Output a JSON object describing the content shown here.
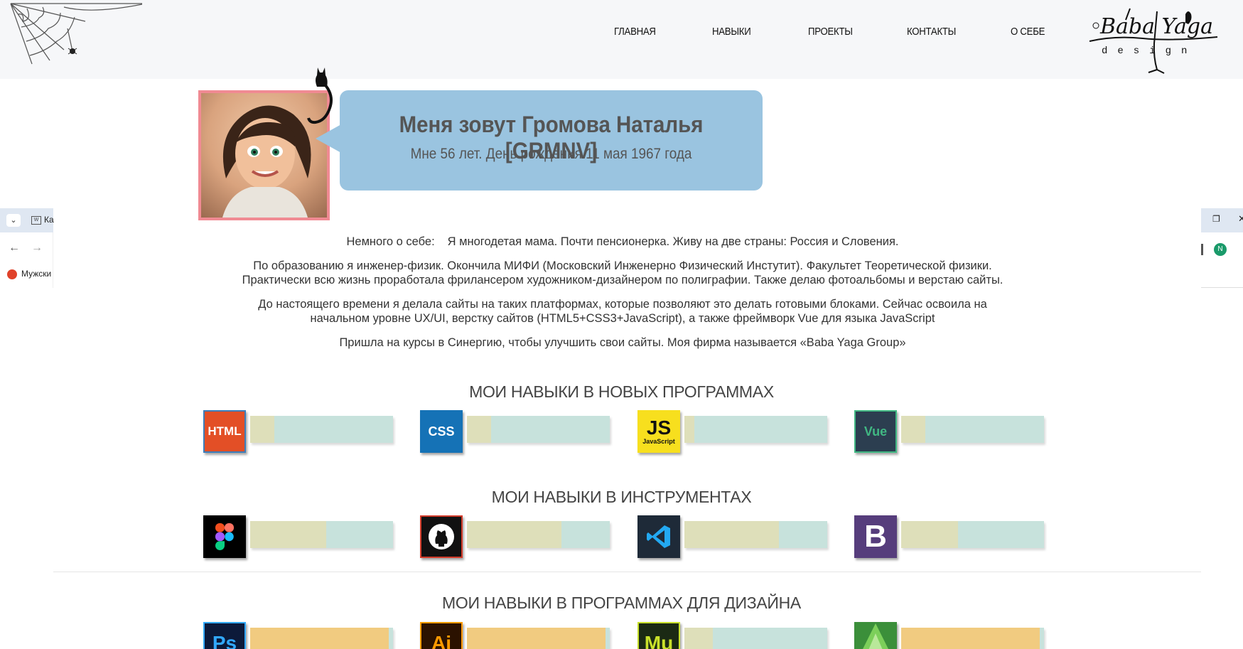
{
  "nav": {
    "items": [
      "ГЛАВНАЯ",
      "НАВЫКИ",
      "ПРОЕКТЫ",
      "КОНТАКТЫ",
      "О СЕБЕ"
    ]
  },
  "logo": {
    "main": "Baba Yaga",
    "sub": "design"
  },
  "profile": {
    "title": "Меня зовут Громова Наталья [GRMNV]",
    "subtitle": "Мне 56 лет. День рождения 11 мая 1967 года"
  },
  "about": {
    "label": "Немного о себе:",
    "line1": "Я многодетая мама. Почти пенсионерка. Живу на две страны: Россия и Словения.",
    "p2": "По образованию я инженер-физик. Окончила МИФИ (Московский Инженерно Физический Инстутит). Факультет Теоретической физики. Практически всю жизнь проработала фрилансером художником-дизайнером по полиграфии. Также делаю фотоальбомы и верстаю сайты.",
    "p3": "До настоящего времени я делала сайты на таких платформах, которые позволяют это делать готовыми блоками. Сейчас освоила на начальном уровне UX/UI, верстку сайтов (HTML5+CSS3+JavaScript), а также фреймворк Vue для языка JavaScript",
    "p4": "Пришла на курсы в Синергию, чтобы улучшить свои сайты. Моя фирма называется «Baba Yaga Group»"
  },
  "sections": [
    {
      "title": "МОИ НАВЫКИ В НОВЫХ ПРОГРАММАХ",
      "skills": [
        {
          "name": "HTML",
          "icon": "html-icon",
          "label": "HTML",
          "color": "#e34f26",
          "level": 0.17
        },
        {
          "name": "CSS",
          "icon": "css-icon",
          "label": "CSS",
          "color": "#1572b6",
          "level": 0.17
        },
        {
          "name": "JavaScript",
          "icon": "javascript-icon",
          "label": "JS",
          "sub": "JavaScript",
          "color": "#f7df1e",
          "level": 0.07
        },
        {
          "name": "Vue",
          "icon": "vue-icon",
          "label": "Vue",
          "color": "#2c3e50",
          "level": 0.17
        }
      ]
    },
    {
      "title": "МОИ НАВЫКИ В ИНСТРУМЕНТАХ",
      "skills": [
        {
          "name": "Figma",
          "icon": "figma-icon",
          "color": "#000000",
          "level": 0.53
        },
        {
          "name": "GitHub",
          "icon": "github-icon",
          "color": "#111111",
          "level": 0.66
        },
        {
          "name": "VS Code",
          "icon": "vscode-icon",
          "color": "#1e2a38",
          "level": 0.66
        },
        {
          "name": "Bootstrap",
          "icon": "bootstrap-icon",
          "label": "B",
          "color": "#563d7c",
          "level": 0.4
        }
      ]
    },
    {
      "title": "МОИ НАВЫКИ В ПРОГРАММАХ ДЛЯ ДИЗАЙНА",
      "skills": [
        {
          "name": "Photoshop",
          "icon": "photoshop-icon",
          "label": "Ps",
          "color": "#0c1a3a",
          "level": 0.97
        },
        {
          "name": "Illustrator",
          "icon": "illustrator-icon",
          "label": "Ai",
          "color": "#2b1200",
          "level": 0.97
        },
        {
          "name": "Muse",
          "icon": "muse-icon",
          "label": "Mu",
          "color": "#1b2a14",
          "level": 0.2
        },
        {
          "name": "Corel",
          "icon": "corel-icon",
          "color": "#3b8f3a",
          "level": 0.97
        }
      ]
    }
  ],
  "browser": {
    "left_tab": "Ка",
    "left_bookmark": "Мужски",
    "right_profile": "N"
  }
}
